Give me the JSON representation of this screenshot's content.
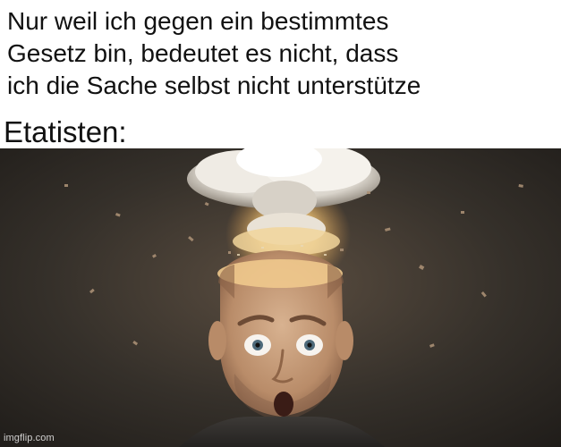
{
  "caption": {
    "lines": [
      "Nur weil ich gegen ein bestimmtes",
      "Gesetz bin, bedeutet es nicht, dass",
      "ich die Sache selbst nicht unterstütze"
    ]
  },
  "label": "Etatisten:",
  "photo": {
    "description_icon": "mind-blown-man-icon"
  },
  "watermark": "imgflip.com",
  "colors": {
    "background": "#ffffff",
    "text": "#111111",
    "photo_backdrop": "#2f2a25",
    "skin": "#c9a07e",
    "cloud": "#e8e4dc",
    "glow": "#f4c979"
  }
}
